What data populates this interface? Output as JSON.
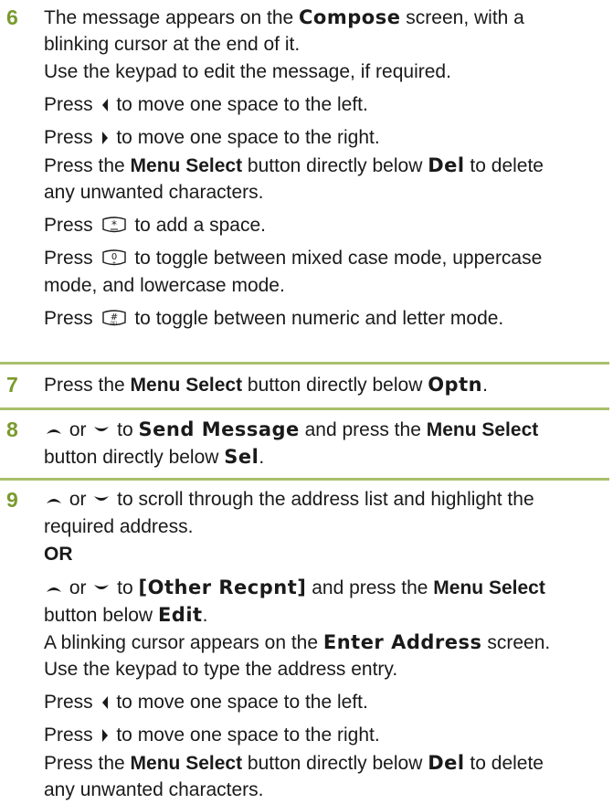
{
  "step6": {
    "number": "6",
    "l1a": "The message appears on the ",
    "l1b": "Compose",
    "l1c": " screen, with a",
    "l2": "blinking cursor at the end of it.",
    "l3": "Use the keypad to edit the message, if required.",
    "l4a": "Press ",
    "l4b": " to move one space to the left.",
    "l5a": "Press ",
    "l5b": " to move one space to the right.",
    "l6a": "Press the ",
    "l6b": "Menu Select",
    "l6c": " button directly below ",
    "l6d": "Del",
    "l6e": " to delete",
    "l7": "any unwanted characters.",
    "l8a": "Press ",
    "l8b": " to add a space.",
    "l9a": "Press ",
    "l9b": " to toggle between mixed case mode, uppercase",
    "l10": "mode, and lowercase mode.",
    "l11a": "Press ",
    "l11b": " to toggle between numeric and letter mode."
  },
  "step7": {
    "number": "7",
    "a": "Press the ",
    "b": "Menu Select",
    "c": " button directly below ",
    "d": "Optn",
    "e": "."
  },
  "step8": {
    "number": "8",
    "a": " or ",
    "b": " to ",
    "c": "Send Message",
    "d": " and press the ",
    "e": "Menu Select",
    "f": "button directly below ",
    "g": "Sel",
    "h": "."
  },
  "step9": {
    "number": "9",
    "l1a": " or ",
    "l1b": " to scroll through the address list and highlight the",
    "l2": "required address.",
    "l3": "OR",
    "l4a": " or ",
    "l4b": " to ",
    "l4c": "[Other Recpnt]",
    "l4d": " and press the ",
    "l4e": "Menu Select",
    "l5a": "button below ",
    "l5b": "Edit",
    "l5c": ".",
    "l6a": "A blinking cursor appears on the ",
    "l6b": "Enter Address",
    "l6c": " screen.",
    "l7": "Use the keypad to type the address entry.",
    "l8a": "Press ",
    "l8b": " to move one space to the left.",
    "l9a": "Press ",
    "l9b": " to move one space to the right.",
    "l10a": "Press the ",
    "l10b": "Menu Select",
    "l10c": " button directly below ",
    "l10d": "Del",
    "l10e": " to delete",
    "l11": "any unwanted characters."
  },
  "colors": {
    "step_number": "#7a9a2e",
    "rule": "#a8bf6a"
  },
  "icons": {
    "left": "left-triangle-icon",
    "right": "right-triangle-icon",
    "up": "up-arrow-icon",
    "down": "down-arrow-icon",
    "star_key": "star-key-icon",
    "zero_key": "zero-key-icon",
    "hash_key": "hash-key-icon"
  }
}
